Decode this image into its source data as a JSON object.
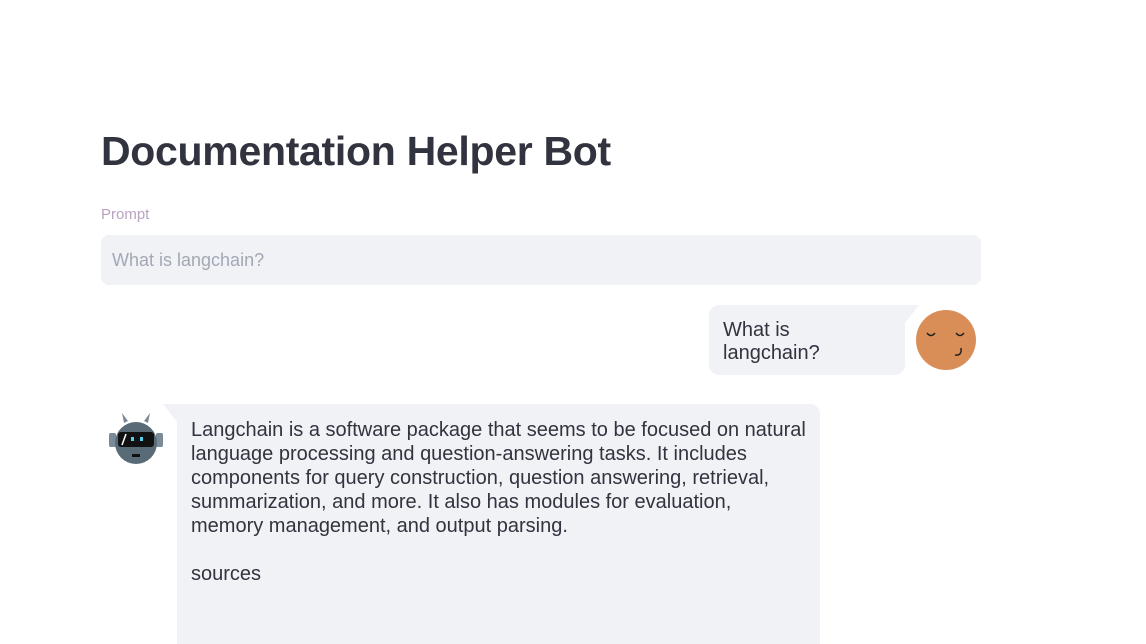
{
  "header": {
    "title": "Documentation Helper Bot"
  },
  "prompt": {
    "label": "Prompt",
    "placeholder": "What is langchain?"
  },
  "chat": {
    "user_message": "What is langchain?",
    "bot_message": "Langchain is a software package that seems to be focused on natural language processing and question-answering tasks. It includes components for query construction, question answering, retrieval, summarization, and more. It also has modules for evaluation, memory management, and output parsing.",
    "bot_sources_label": "sources"
  },
  "icons": {
    "user_avatar": "sleepy-face-avatar-icon",
    "bot_avatar": "robot-avatar-icon"
  },
  "colors": {
    "bubble": "#f0f2f6",
    "user_avatar": "#d98e57",
    "bot_avatar": "#5a6b78"
  }
}
